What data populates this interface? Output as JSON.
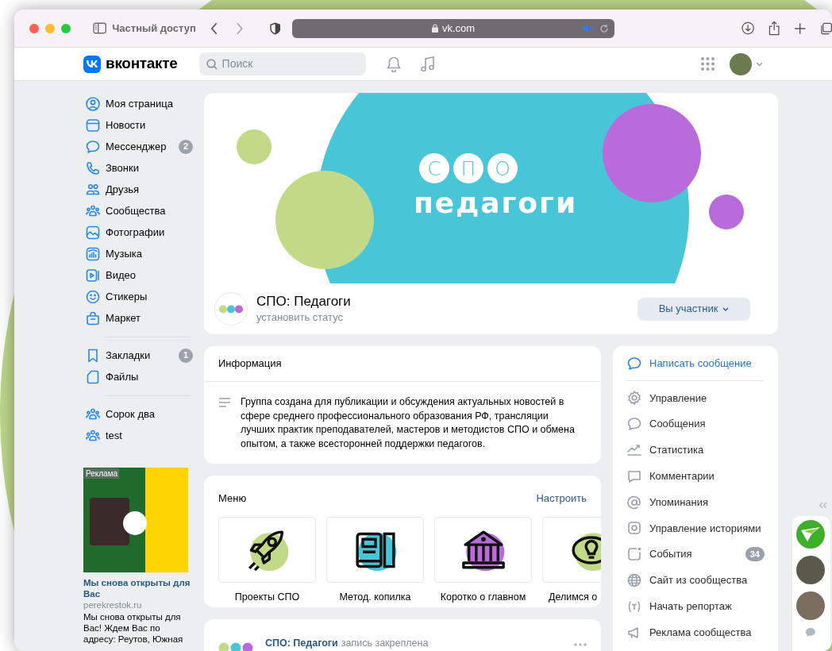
{
  "browser": {
    "tab_label": "Частный доступ",
    "address": "vk.com"
  },
  "header": {
    "logo_text": "вконтакте",
    "search_placeholder": "Поиск"
  },
  "nav_sections": [
    {
      "items": [
        {
          "label": "Моя страница"
        },
        {
          "label": "Новости"
        },
        {
          "label": "Мессенджер",
          "badge": "2"
        },
        {
          "label": "Звонки"
        },
        {
          "label": "Друзья"
        },
        {
          "label": "Сообщества"
        },
        {
          "label": "Фотографии"
        },
        {
          "label": "Музыка"
        },
        {
          "label": "Видео"
        },
        {
          "label": "Стикеры"
        },
        {
          "label": "Маркет"
        }
      ]
    },
    {
      "items": [
        {
          "label": "Закладки",
          "badge": "1"
        },
        {
          "label": "Файлы"
        }
      ]
    },
    {
      "items": [
        {
          "label": "Сорок два"
        },
        {
          "label": "test"
        }
      ]
    }
  ],
  "ad": {
    "badge": "Реклама",
    "title": "Мы снова открыты для Вас",
    "domain": "perekrestok.ru",
    "text": "Мы снова открыты для Вас! Ждем Вас по адресу: Реутов, Южная"
  },
  "cover": {
    "letters": [
      "С",
      "П",
      "О"
    ],
    "title": "педагоги"
  },
  "group": {
    "name": "СПО: Педагоги",
    "status": "установить статус",
    "member_button": "Вы участник"
  },
  "info": {
    "title": "Информация",
    "description": "Группа создана для публикации и обсуждения актуальных новостей в сфере среднего профессионального образования РФ, трансляции лучших практик преподавателей, мастеров и методистов СПО и обмена опытом, а также всесторонней поддержки педагогов."
  },
  "menu": {
    "title": "Меню",
    "action": "Настроить",
    "items": [
      {
        "label": "Проекты СПО",
        "color": "#c2d987"
      },
      {
        "label": "Метод. копилка",
        "color": "#48c6d8"
      },
      {
        "label": "Коротко о главном",
        "color": "#b96bdc"
      },
      {
        "label": "Делимся о",
        "color": "#c2d987"
      }
    ]
  },
  "post": {
    "author": "СПО: Педагоги",
    "note": "запись закреплена"
  },
  "actions": {
    "primary": "Написать сообщение",
    "items": [
      {
        "label": "Управление"
      },
      {
        "label": "Сообщения"
      },
      {
        "label": "Статистика"
      },
      {
        "label": "Комментарии"
      },
      {
        "label": "Упоминания"
      },
      {
        "label": "Управление историями"
      },
      {
        "label": "События",
        "badge": "34"
      },
      {
        "label": "Сайт из сообщества"
      },
      {
        "label": "Начать репортаж"
      },
      {
        "label": "Реклама сообщества"
      }
    ]
  }
}
